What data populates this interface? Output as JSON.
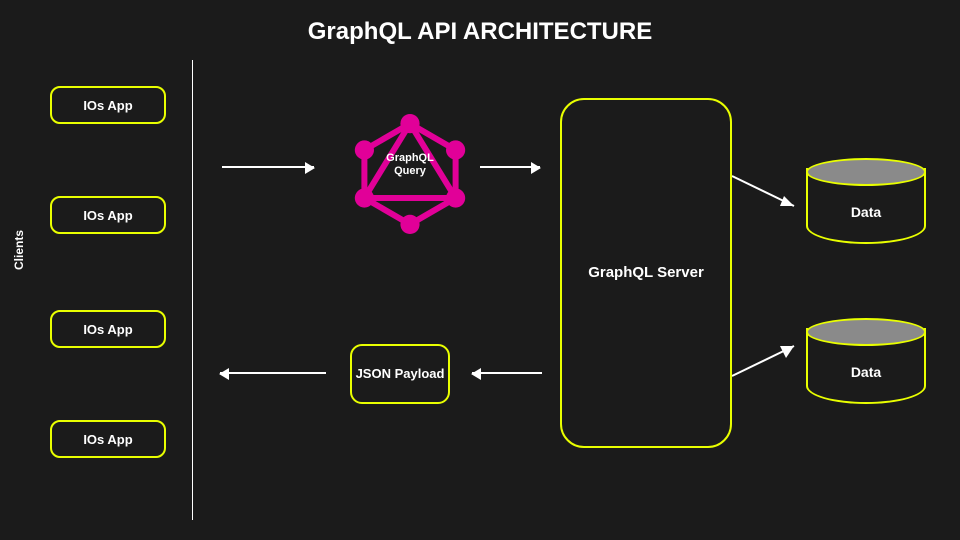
{
  "title": "GraphQL API ARCHITECTURE",
  "sidebar": {
    "group_label": "Clients",
    "items": [
      "IOs App",
      "IOs App",
      "IOs App",
      "IOs App"
    ]
  },
  "nodes": {
    "graphql_query": "GraphQL Query",
    "json_payload": "JSON Payload",
    "server": "GraphQL Server",
    "data_1": "Data",
    "data_2": "Data"
  },
  "colors": {
    "accent": "#e9ff00",
    "logo": "#e10098",
    "bg": "#1b1b1b"
  }
}
